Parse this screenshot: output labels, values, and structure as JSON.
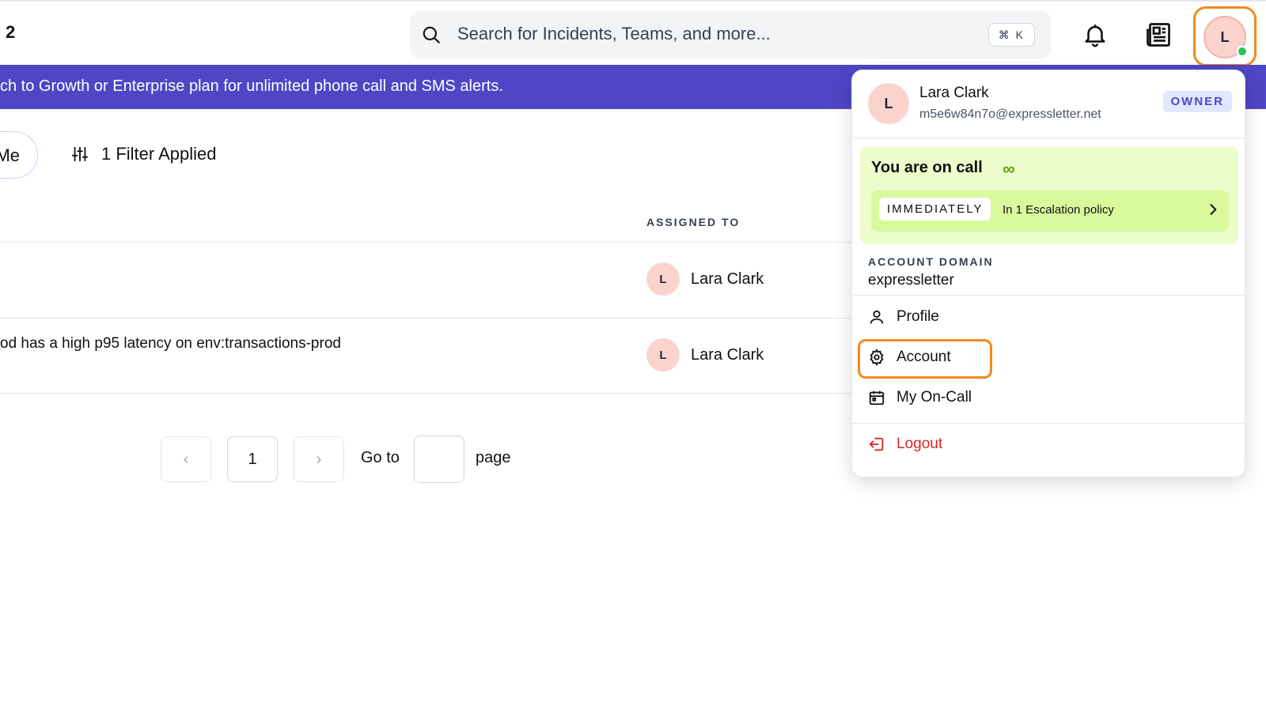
{
  "header": {
    "count": "2",
    "search_placeholder": "Search for Incidents, Teams, and more...",
    "search_shortcut": "⌘ K",
    "avatar_initial": "L"
  },
  "banner": {
    "text": "ch to Growth or Enterprise plan for unlimited phone call and SMS alerts."
  },
  "filters": {
    "me_label": "Me",
    "filter_label": "1 Filter Applied"
  },
  "table": {
    "assigned_header": "ASSIGNED TO",
    "rows": [
      {
        "title": "",
        "assignee_initial": "L",
        "assignee": "Lara Clark"
      },
      {
        "title": "od has a high p95 latency on env:transactions-prod",
        "assignee_initial": "L",
        "assignee": "Lara Clark"
      }
    ]
  },
  "pagination": {
    "prev": "‹",
    "current": "1",
    "next": "›",
    "goto_label": "Go to",
    "page_label": "page"
  },
  "dropdown": {
    "user_initial": "L",
    "user_name": "Lara Clark",
    "user_email": "m5e6w84n7o@expressletter.net",
    "role": "OWNER",
    "oncall_title": "You are on call",
    "oncall_symbol": "∞",
    "oncall_tag": "IMMEDIATELY",
    "oncall_desc": "In 1 Escalation policy",
    "domain_label": "ACCOUNT DOMAIN",
    "domain_value": "expressletter",
    "items": [
      {
        "label": "Profile",
        "icon": "user-icon"
      },
      {
        "label": "Account",
        "icon": "gear-icon"
      },
      {
        "label": "My On-Call",
        "icon": "calendar-icon"
      },
      {
        "label": "Logout",
        "icon": "logout-icon"
      }
    ]
  },
  "colors": {
    "banner": "#4f46c5",
    "highlight": "#f28a1c",
    "oncall_bg": "#ecfccb",
    "logout": "#dc2626"
  }
}
